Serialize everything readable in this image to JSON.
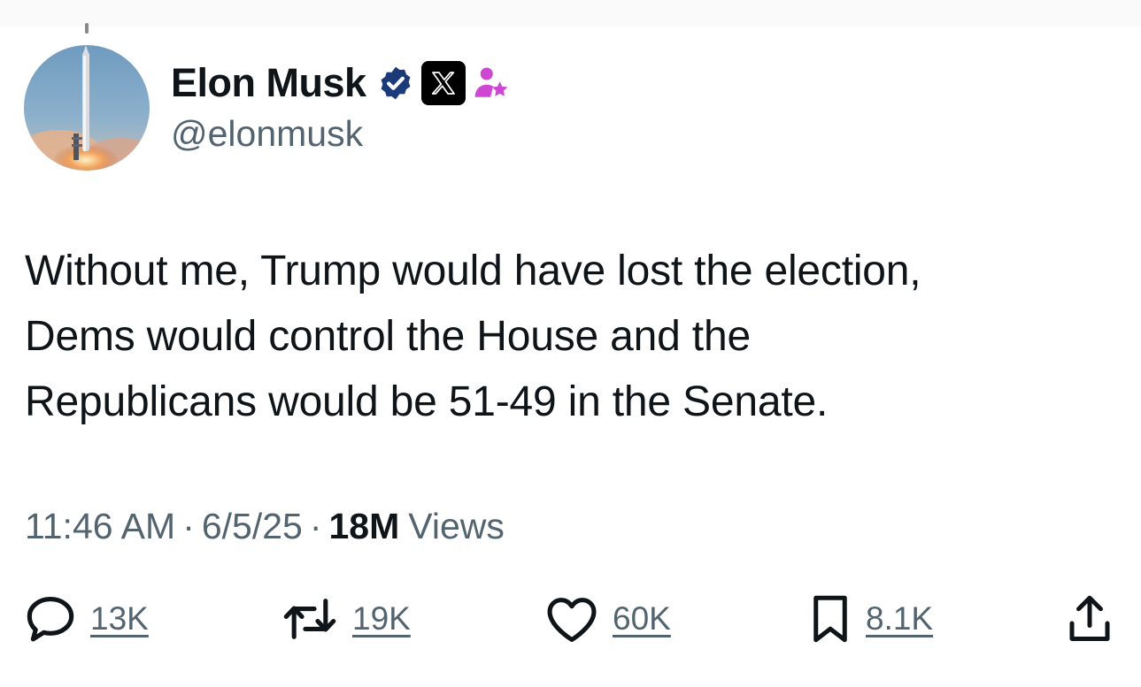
{
  "author": {
    "name": "Elon Musk",
    "handle": "@elonmusk",
    "badges": [
      "verified-badge-icon",
      "x-affiliate-logo-icon",
      "affiliate-person-star-icon"
    ],
    "avatar": "rocket-launch-photo"
  },
  "tweet": {
    "lines": [
      "Without me, Trump would have lost the election,",
      "Dems would control the House and the",
      "Republicans would be 51-49 in the Senate."
    ]
  },
  "meta": {
    "time": "11:46 AM",
    "separator": "·",
    "date": "6/5/25",
    "views_count": "18M",
    "views_label": "Views"
  },
  "actions": {
    "reply": {
      "icon": "reply-bubble-icon",
      "count": "13K"
    },
    "retweet": {
      "icon": "retweet-icon",
      "count": "19K"
    },
    "like": {
      "icon": "heart-icon",
      "count": "60K"
    },
    "bookmark": {
      "icon": "bookmark-icon",
      "count": "8.1K"
    },
    "share": {
      "icon": "share-icon"
    }
  },
  "colors": {
    "text": "#0f1419",
    "secondary": "#536471",
    "verified": "#1d9bf0",
    "verified_dark": "#1a3a7a",
    "affiliate": "#d046d4"
  }
}
